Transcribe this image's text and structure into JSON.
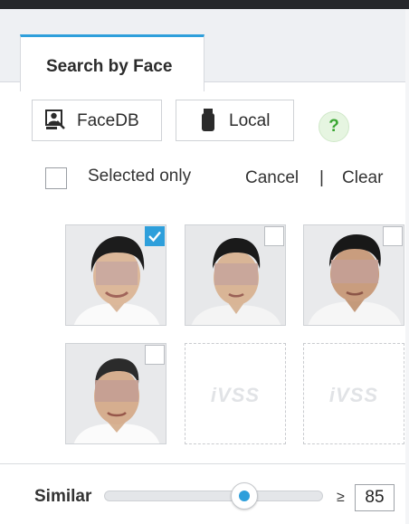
{
  "tab": {
    "label": "Search by Face"
  },
  "toolbar": {
    "facedb_label": "FaceDB",
    "facedb_icon": "person-card-icon",
    "local_label": "Local",
    "local_icon": "usb-drive-icon",
    "help_icon_glyph": "?",
    "help_icon": "question-icon"
  },
  "filters": {
    "selected_only_label": "Selected only",
    "selected_only_checked": false,
    "cancel_label": "Cancel",
    "separator": "|",
    "clear_label": "Clear"
  },
  "faces": [
    {
      "type": "photo",
      "checked": true
    },
    {
      "type": "photo",
      "checked": false
    },
    {
      "type": "photo",
      "checked": false
    },
    {
      "type": "photo",
      "checked": false
    },
    {
      "type": "placeholder",
      "text": "iVSS"
    },
    {
      "type": "placeholder",
      "text": "iVSS"
    }
  ],
  "similarity": {
    "label": "Similar",
    "operator": "≥",
    "value": "85"
  },
  "colors": {
    "accent": "#2e9fdb",
    "help_green": "#3aa632",
    "topbar": "#26272b"
  }
}
